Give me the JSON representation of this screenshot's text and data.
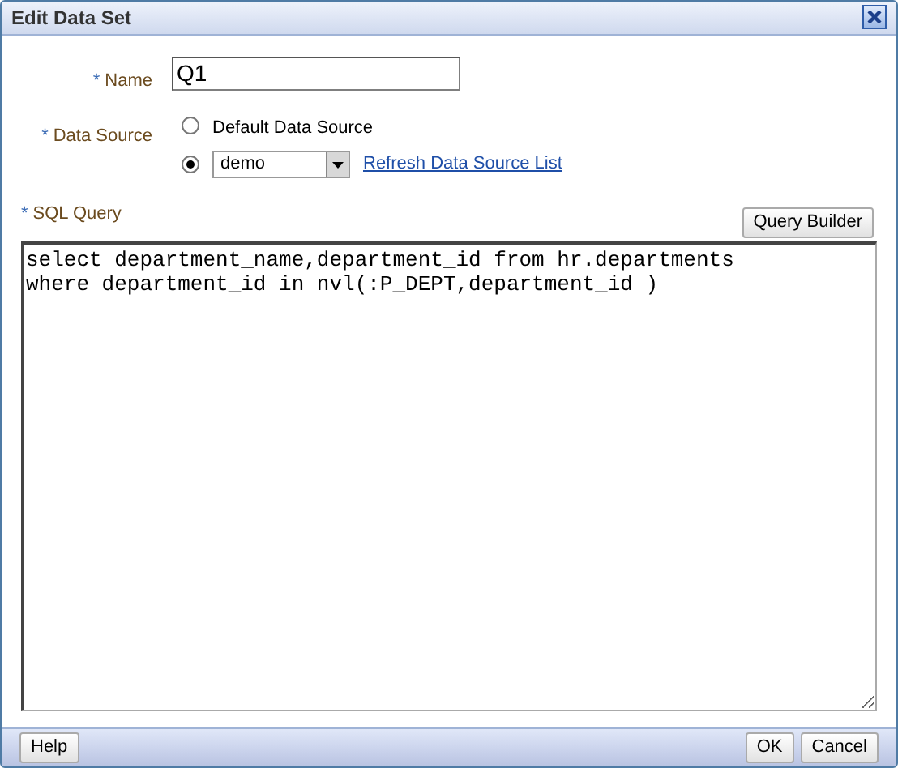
{
  "window": {
    "title": "Edit Data Set"
  },
  "name_field": {
    "required_mark": "*",
    "label": "Name",
    "value": "Q1"
  },
  "data_source": {
    "required_mark": "*",
    "label": "Data Source",
    "options": [
      {
        "kind": "radio",
        "label": "Default Data Source",
        "selected": false
      },
      {
        "kind": "select",
        "value": "demo",
        "selected": true,
        "link": "Refresh Data Source List"
      }
    ]
  },
  "sql_query": {
    "required_mark": "*",
    "label": "SQL Query",
    "button": "Query Builder",
    "value": "select department_name,department_id from hr.departments\nwhere department_id in nvl(:P_DEPT,department_id )"
  },
  "footer": {
    "left_buttons": [
      "Help"
    ],
    "right_buttons": [
      "OK",
      "Cancel"
    ]
  }
}
